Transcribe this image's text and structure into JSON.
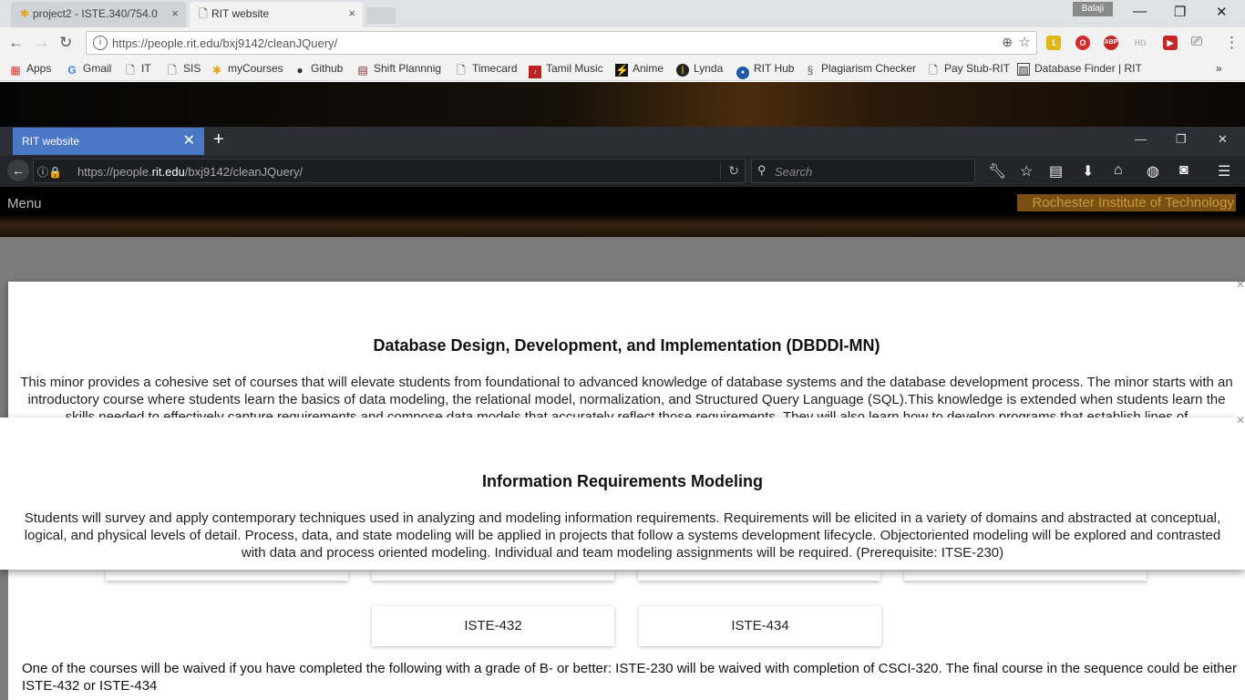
{
  "chrome": {
    "tabs": [
      {
        "title": "project2 - ISTE.340/754.0",
        "close": "×"
      },
      {
        "title": "RIT website",
        "close": "×"
      }
    ],
    "profile": "Balaji",
    "url": "https://people.rit.edu/bxj9142/cleanJQuery/",
    "extensions": [
      {
        "name": "notes-ext",
        "label": "1",
        "color": "#e2b512"
      },
      {
        "name": "opera-ext",
        "label": "O",
        "color": "#d12b2b"
      },
      {
        "name": "abp-ext",
        "label": "ABP",
        "color": "#c62828"
      },
      {
        "name": "hd-ext",
        "label": "HD",
        "color": "#bbbbbb"
      },
      {
        "name": "youtube-ext",
        "label": "▶",
        "color": "#c62828"
      }
    ],
    "bookmarks": [
      {
        "icon": "apps-icon",
        "label": "Apps"
      },
      {
        "icon": "google-icon",
        "label": "Gmail"
      },
      {
        "icon": "page-icon",
        "label": "IT"
      },
      {
        "icon": "page-icon",
        "label": "SIS"
      },
      {
        "icon": "mycourses-icon",
        "label": "myCourses"
      },
      {
        "icon": "github-icon",
        "label": "Github"
      },
      {
        "icon": "calendar-icon",
        "label": "Shift Plannnig"
      },
      {
        "icon": "page-icon",
        "label": "Timecard"
      },
      {
        "icon": "music-icon",
        "label": "Tamil Music"
      },
      {
        "icon": "anime-icon",
        "label": "Anime"
      },
      {
        "icon": "lynda-icon",
        "label": "Lynda"
      },
      {
        "icon": "rithub-icon",
        "label": "RIT Hub"
      },
      {
        "icon": "plagiarism-icon",
        "label": "Plagiarism Checker"
      },
      {
        "icon": "page-icon",
        "label": "Pay Stub-RIT"
      },
      {
        "icon": "database-icon",
        "label": "Database Finder | RIT"
      }
    ],
    "more": "»"
  },
  "firefox": {
    "tab_title": "RIT website",
    "url_prefix": "https://people.",
    "url_domain": "rit.edu",
    "url_path": "/bxj9142/cleanJQuery/",
    "search_placeholder": "Search"
  },
  "site": {
    "menu_label": "Menu",
    "logo_text": "Rochester Institute of Technology"
  },
  "modals": [
    {
      "title": "Database Design, Development, and Implementation (DBDDI-MN)",
      "body": "This minor provides a cohesive set of courses that will elevate students from foundational to advanced knowledge of database systems and the database development process. The minor starts with an introductory course where students learn the basics of data modeling, the relational model, normalization, and Structured Query Language (SQL).This knowledge is extended when students learn the skills needed to effectively capture requirements and compose data models that accurately reflect those requirements. They will also learn how to develop programs that establish lines of"
    },
    {
      "title": "Information Requirements Modeling",
      "body": "Students will survey and apply contemporary techniques used in analyzing and modeling information requirements. Requirements will be elicited in a variety of domains and abstracted at conceptual, logical, and physical levels of detail. Process, data, and state modeling will be applied in projects that follow a systems development lifecycle. Objectoriented modeling will be explored and contrasted with data and process oriented modeling. Individual and team modeling assignments will be required. (Prerequisite: ITSE-230)"
    }
  ],
  "courses": [
    "ISTE-432",
    "ISTE-434"
  ],
  "waiver_text": "One of the courses will be waived if you have completed the following with a grade of B- or better: ISTE-230 will be waived with completion of CSCI-320. The final course in the sequence could be either ISTE-432 or ISTE-434"
}
